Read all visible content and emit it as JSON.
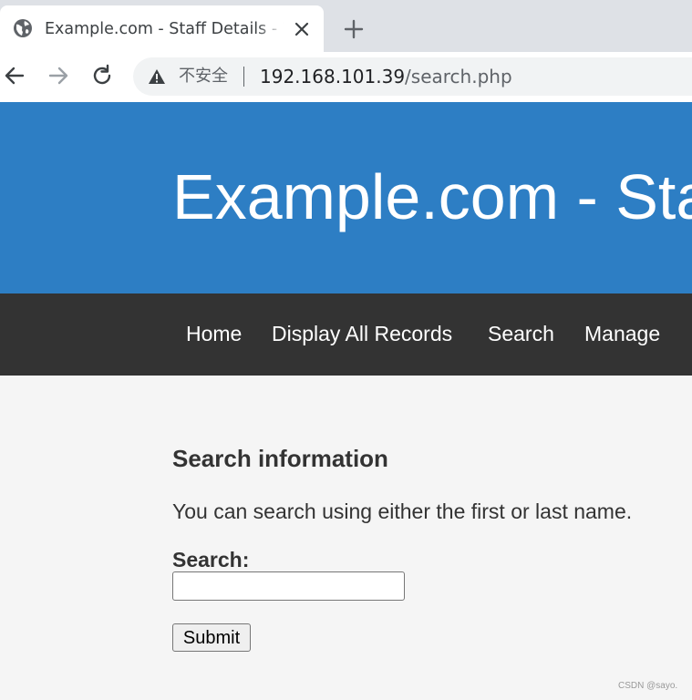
{
  "browser": {
    "tab_title": "Example.com - Staff Details - Welcome",
    "insecure_label": "不安全",
    "url_host": "192.168.101.39",
    "url_path": "/search.php"
  },
  "header": {
    "title": "Example.com - Staff Details - Welcome"
  },
  "nav": {
    "items": [
      "Home",
      "Display All Records",
      "Search",
      "Manage"
    ]
  },
  "main": {
    "heading": "Search information",
    "description": "You can search using either the first or last name.",
    "search_label": "Search:",
    "search_value": "",
    "submit_label": "Submit"
  },
  "watermark": "CSDN @sayo.",
  "colors": {
    "header_bg": "#2d7ec4",
    "nav_bg": "#333333",
    "page_bg": "#f5f5f5"
  }
}
